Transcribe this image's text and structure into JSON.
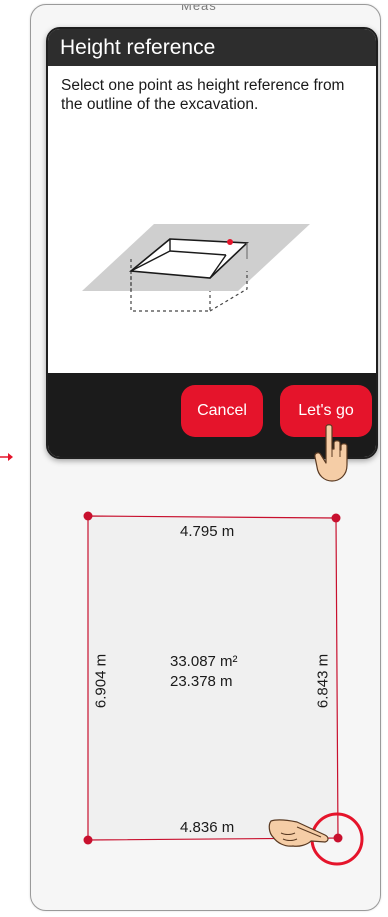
{
  "background": {
    "top_text": "Meas"
  },
  "dialog": {
    "title": "Height reference",
    "message": "Select one point as height reference from the outline of the excavation.",
    "cancel_label": "Cancel",
    "go_label": "Let's go"
  },
  "plan": {
    "top_length": "4.795 m",
    "bottom_length": "4.836 m",
    "left_length": "6.904 m",
    "right_length": "6.843 m",
    "area": "33.087 m²",
    "perimeter": "23.378 m"
  },
  "colors": {
    "accent": "#e5142b",
    "outline": "#c8102e",
    "dark": "#1b1b1b"
  },
  "icons": {
    "pointer": "hand-pointer-icon"
  }
}
